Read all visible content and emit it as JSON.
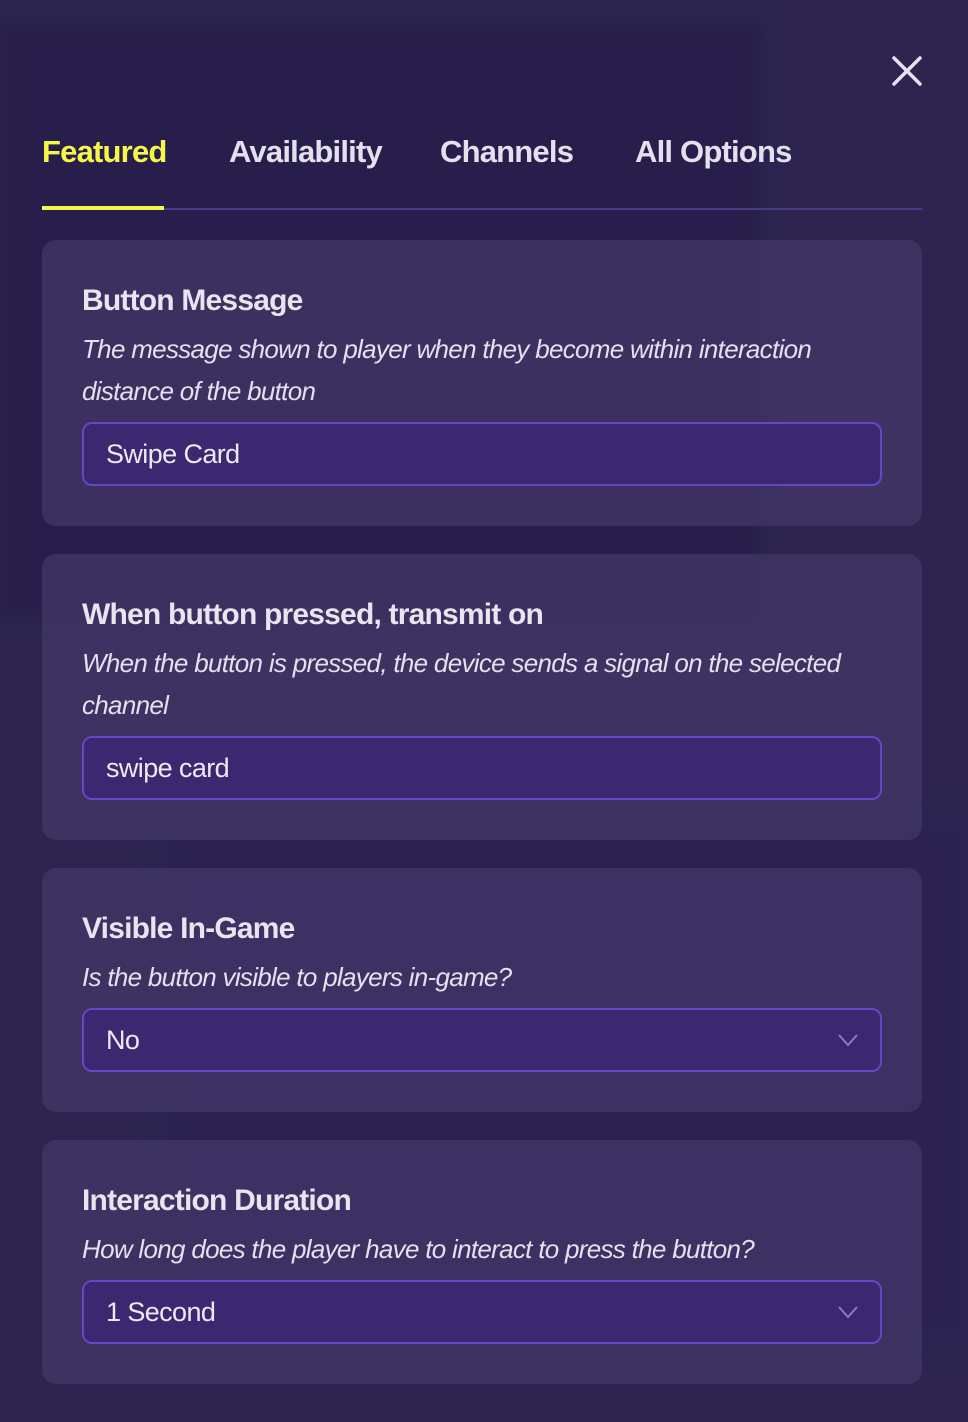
{
  "tabs": [
    {
      "label": "Featured",
      "active": true
    },
    {
      "label": "Availability",
      "active": false
    },
    {
      "label": "Channels",
      "active": false
    },
    {
      "label": "All Options",
      "active": false
    }
  ],
  "colors": {
    "accent": "#f7f74a",
    "input_bg": "#3c2870",
    "input_border": "#6646c4",
    "text": "#e6e2f0"
  },
  "close_icon": "close-icon",
  "sections": [
    {
      "title": "Button Message",
      "description": "The message shown to player when they become within interaction distance of the button",
      "type": "text-input",
      "value": "Swipe Card"
    },
    {
      "title": "When button pressed, transmit on",
      "description": "When the button is pressed, the device sends a signal on the selected channel",
      "type": "text-input",
      "value": "swipe card"
    },
    {
      "title": "Visible In-Game",
      "description": "Is the button visible to players in-game?",
      "type": "select",
      "value": "No"
    },
    {
      "title": "Interaction Duration",
      "description": "How long does the player have to interact to press the button?",
      "type": "select",
      "value": "1 Second"
    }
  ]
}
